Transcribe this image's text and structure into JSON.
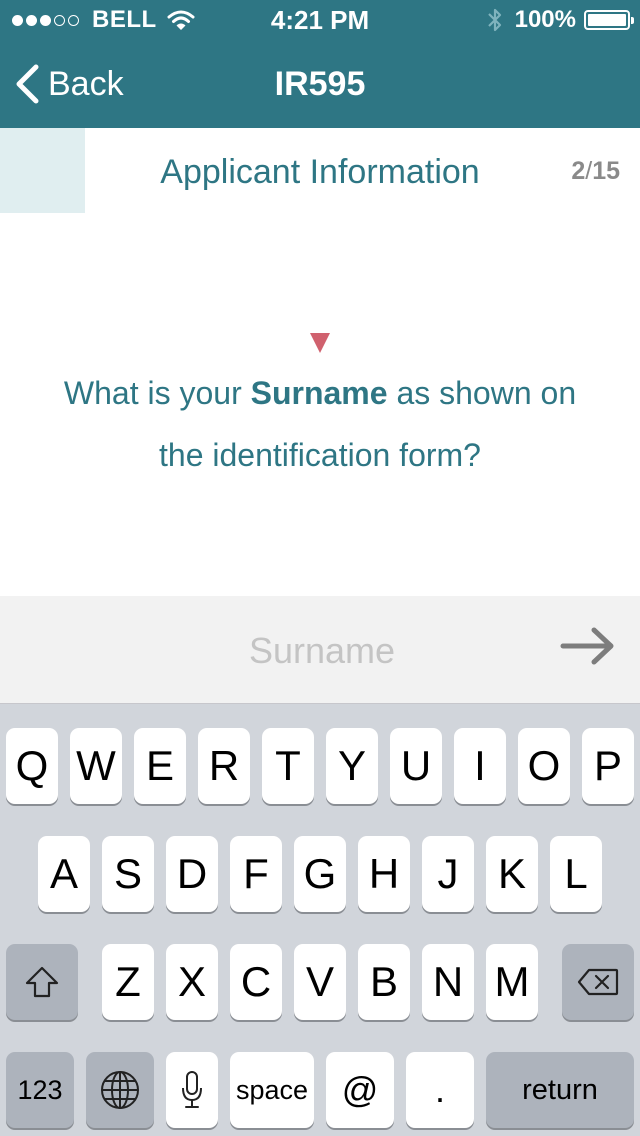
{
  "status_bar": {
    "carrier": "BELL",
    "signal_bars_filled": 3,
    "signal_bars_total": 5,
    "time": "4:21 PM",
    "battery": "100%",
    "icons": [
      "signal-dots-icon",
      "wifi-icon",
      "bluetooth-icon",
      "battery-icon"
    ]
  },
  "nav": {
    "back_label": "Back",
    "title": "IR595"
  },
  "section": {
    "title": "Applicant Information",
    "step_current": "2",
    "step_separator": "/",
    "step_total": "15"
  },
  "question": {
    "prefix": "What is your ",
    "emphasis": "Surname",
    "suffix": " as shown on the identification form?"
  },
  "input": {
    "value": "",
    "placeholder": "Surname"
  },
  "keyboard": {
    "row1": [
      "Q",
      "W",
      "E",
      "R",
      "T",
      "Y",
      "U",
      "I",
      "O",
      "P"
    ],
    "row2": [
      "A",
      "S",
      "D",
      "F",
      "G",
      "H",
      "J",
      "K",
      "L"
    ],
    "row3": [
      "Z",
      "X",
      "C",
      "V",
      "B",
      "N",
      "M"
    ],
    "numbers_label": "123",
    "space_label": "space",
    "at_label": "@",
    "period_label": ".",
    "return_label": "return"
  },
  "colors": {
    "header": "#2e7684",
    "accent_text": "#2e7684",
    "marker": "#d0616e",
    "progress_block": "#e0eef0",
    "keyboard_bg": "#d1d5db"
  }
}
